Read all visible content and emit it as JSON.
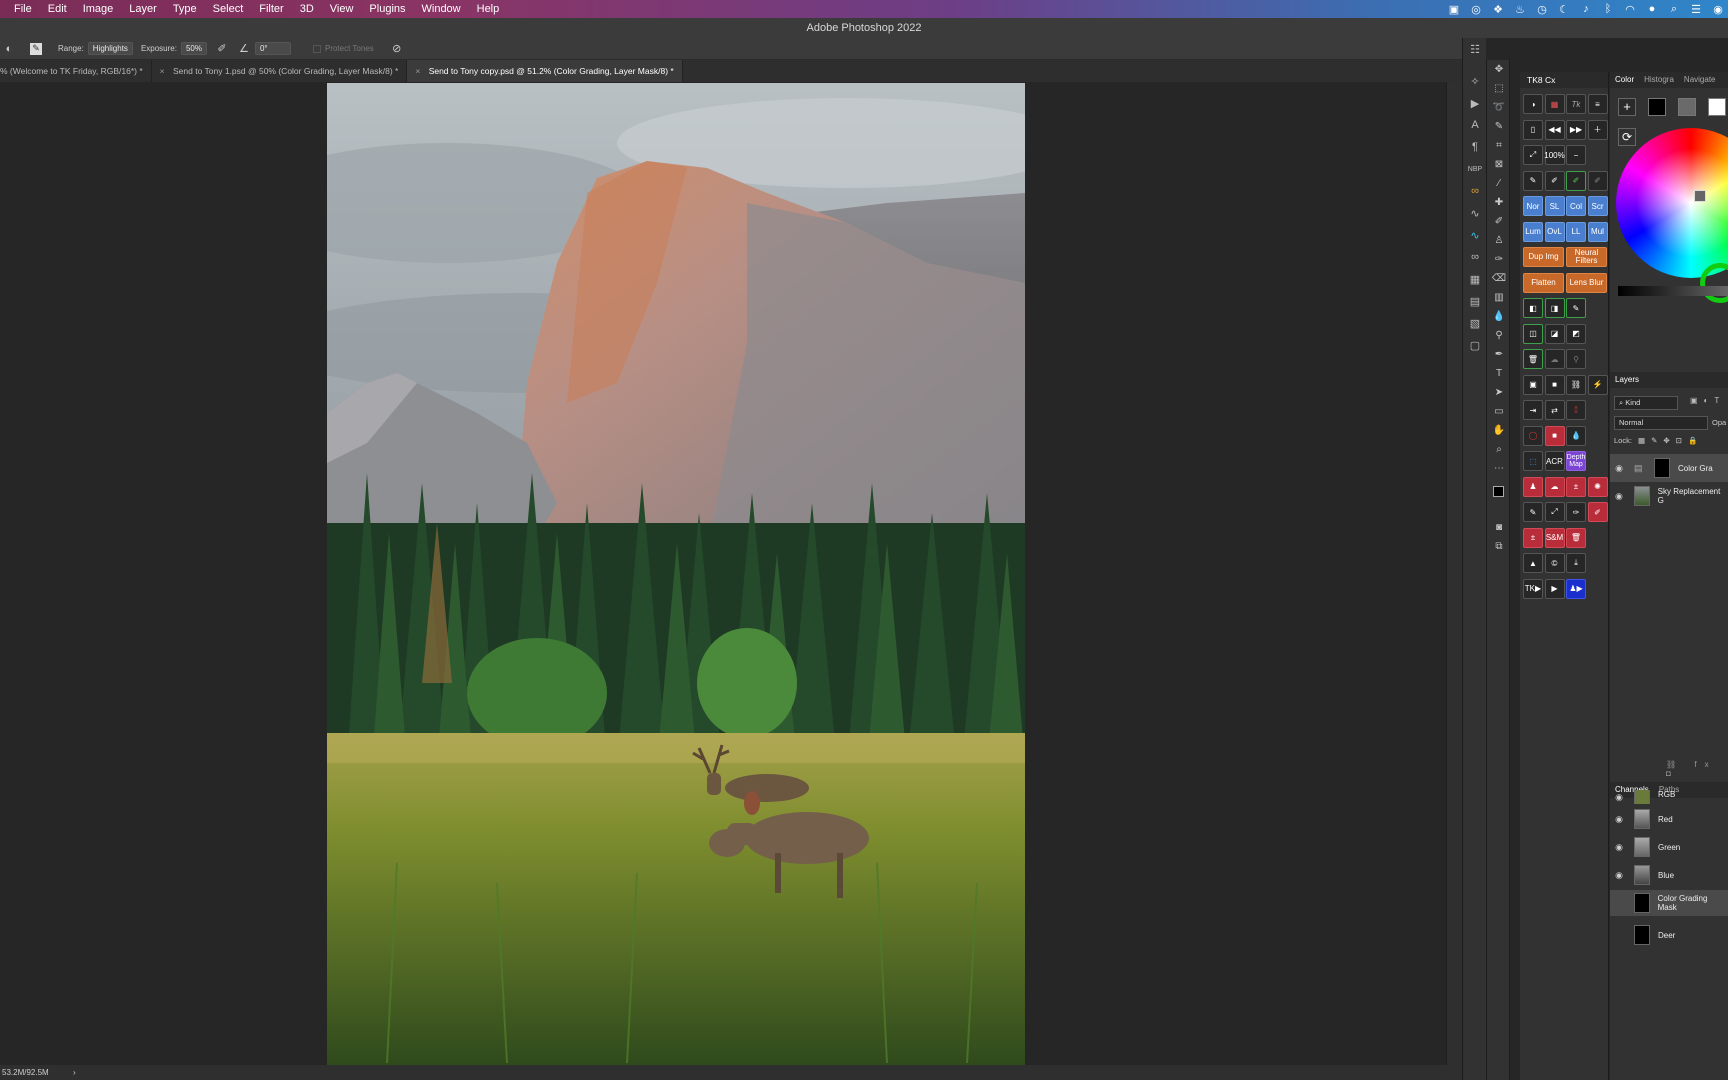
{
  "menubar": {
    "items": [
      "File",
      "Edit",
      "Image",
      "Layer",
      "Type",
      "Select",
      "Filter",
      "3D",
      "View",
      "Plugins",
      "Window",
      "Help"
    ]
  },
  "window": {
    "title": "Adobe Photoshop 2022"
  },
  "options_bar": {
    "range_label": "Range:",
    "range_value": "Highlights",
    "exposure_label": "Exposure:",
    "exposure_value": "50%",
    "angle_value": "0°",
    "protect_tones": "Protect Tones"
  },
  "tabs": [
    {
      "label": "% (Welcome to TK Friday, RGB/16*) *",
      "active": false
    },
    {
      "label": "Send to Tony 1.psd @ 50% (Color Grading, Layer Mask/8) *",
      "active": false
    },
    {
      "label": "Send to Tony copy.psd @ 51.2% (Color Grading, Layer Mask/8) *",
      "active": true
    }
  ],
  "status": {
    "doc_size": "53.2M/92.5M"
  },
  "tk8": {
    "title": "TK8 Cx",
    "buttons": [
      "",
      "",
      "Tk",
      "",
      "",
      "",
      "",
      "",
      "",
      "100%",
      "",
      "",
      "",
      "",
      "",
      "",
      "Nor",
      "SL",
      "Col",
      "Scr",
      "Lum",
      "OvL",
      "LL",
      "Mul"
    ],
    "wide_buttons": [
      {
        "label": "Dup Img"
      },
      {
        "label": "Neural Filters"
      },
      {
        "label": "Flatten"
      },
      {
        "label": "Lens Blur"
      }
    ],
    "labeled_small": {
      "acr": "ACR",
      "depth_map": "Depth Map",
      "sm": "S&M",
      "tk": "TK"
    }
  },
  "color_panel": {
    "tabs": [
      "Color",
      "Histogra",
      "Navigate"
    ]
  },
  "layers_panel": {
    "title": "Layers",
    "filter": "Kind",
    "blend_mode": "Normal",
    "opacity_label": "Opa",
    "lock_label": "Lock:",
    "layers": [
      {
        "name": "Color Gra"
      },
      {
        "name": "Sky Replacement G"
      }
    ]
  },
  "channels_panel": {
    "tabs": [
      "Channels",
      "Paths"
    ],
    "channels": [
      {
        "name": "RGB"
      },
      {
        "name": "Red"
      },
      {
        "name": "Green"
      },
      {
        "name": "Blue"
      },
      {
        "name": "Color Grading Mask"
      },
      {
        "name": "Deer"
      }
    ]
  }
}
